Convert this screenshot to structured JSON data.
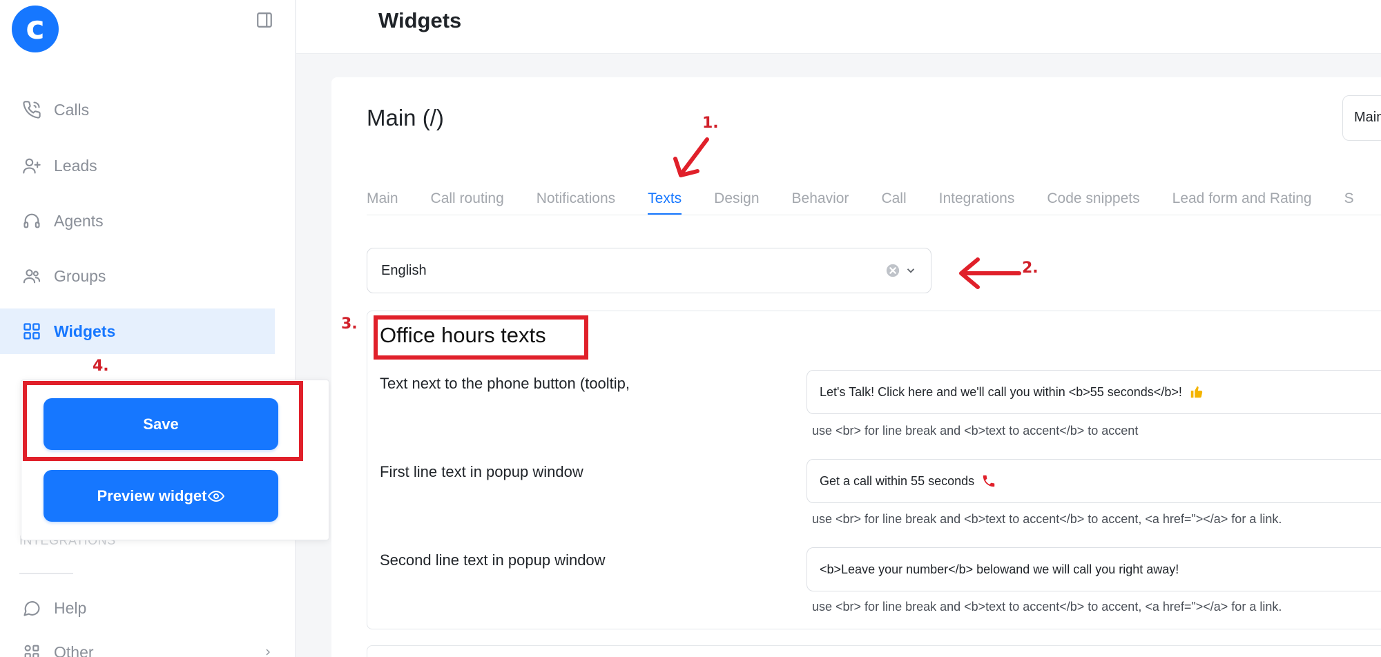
{
  "sidebar": {
    "logo_letter": "c",
    "nav": [
      {
        "label": "Calls",
        "icon": "phone-icon"
      },
      {
        "label": "Leads",
        "icon": "user-plus-icon"
      },
      {
        "label": "Agents",
        "icon": "headset-icon"
      },
      {
        "label": "Groups",
        "icon": "users-icon"
      },
      {
        "label": "Widgets",
        "icon": "grid-icon",
        "active": true
      },
      {
        "label": "Help",
        "icon": "chat-icon"
      },
      {
        "label": "Other",
        "icon": "apps-icon"
      }
    ],
    "faded_item": "INTEGRATIONS",
    "save_label": "Save",
    "preview_label": "Preview widget"
  },
  "header": {
    "title": "Widgets"
  },
  "main": {
    "title": "Main (/)",
    "select_value": "Main",
    "tabs": [
      {
        "label": "Main"
      },
      {
        "label": "Call routing"
      },
      {
        "label": "Notifications"
      },
      {
        "label": "Texts",
        "active": true
      },
      {
        "label": "Design"
      },
      {
        "label": "Behavior"
      },
      {
        "label": "Call"
      },
      {
        "label": "Integrations"
      },
      {
        "label": "Code snippets"
      },
      {
        "label": "Lead form and Rating"
      },
      {
        "label": "S"
      }
    ],
    "language": "English",
    "section_title": "Office hours texts",
    "fields": [
      {
        "label": "Text next to the phone button (tooltip,",
        "value": "Let's Talk! Click here and we'll call you within <b>55 seconds</b>!",
        "emoji": "thumbs-up-icon",
        "hint": "use <br> for line break and <b>text to accent</b> to accent"
      },
      {
        "label": "First line text in popup window",
        "value": "Get a call within 55 seconds",
        "emoji": "phone-receiver-icon",
        "hint": "use <br> for line break and <b>text to accent</b> to accent, <a href=\"></a> for a link."
      },
      {
        "label": "Second line text in popup window",
        "value": "<b>Leave your number</b> belowand we will call you right away!",
        "hint": "use <br> for line break and <b>text to accent</b> to accent, <a href=\"></a> for a link."
      }
    ]
  },
  "annotations": [
    "1.",
    "2.",
    "3.",
    "4."
  ],
  "colors": {
    "primary": "#1677ff",
    "annotation": "#e0202a",
    "active_bg": "#e6f0fd"
  }
}
